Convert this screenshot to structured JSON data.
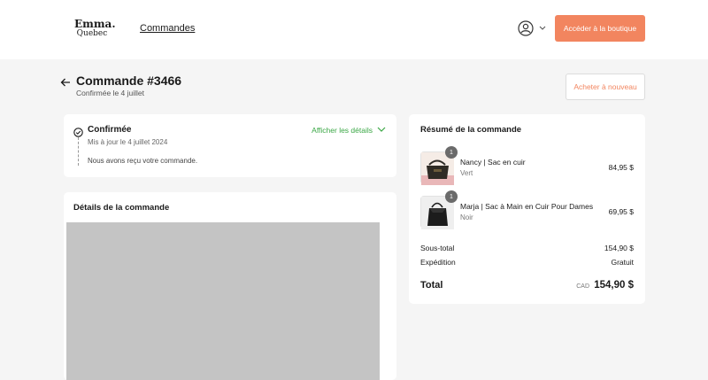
{
  "header": {
    "logo_main": "Emma.",
    "logo_sub": "Quebec",
    "nav_orders": "Commandes",
    "account_icon": "user-circle-icon",
    "shop_button": "Accéder à la boutique"
  },
  "order": {
    "title": "Commande #3466",
    "subtitle": "Confirmée le 4 juillet",
    "reorder_button": "Acheter à nouveau"
  },
  "status": {
    "title": "Confirmée",
    "updated": "Mis à jour le 4 juillet 2024",
    "message": "Nous avons reçu votre commande.",
    "details_link": "Afficher les détails"
  },
  "details": {
    "title": "Détails de la commande"
  },
  "summary": {
    "title": "Résumé de la commande",
    "items": [
      {
        "name": "Nancy | Sac en cuir",
        "variant": "Vert",
        "price": "84,95 $",
        "qty": "1"
      },
      {
        "name": "Marja | Sac à Main en Cuir Pour Dames",
        "variant": "Noir",
        "price": "69,95 $",
        "qty": "1"
      }
    ],
    "subtotal_label": "Sous-total",
    "subtotal_value": "154,90 $",
    "shipping_label": "Expédition",
    "shipping_value": "Gratuit",
    "total_label": "Total",
    "total_currency": "CAD",
    "total_value": "154,90 $"
  },
  "colors": {
    "accent": "#f2855f",
    "success": "#3aa745",
    "background": "#f5f5f5"
  }
}
